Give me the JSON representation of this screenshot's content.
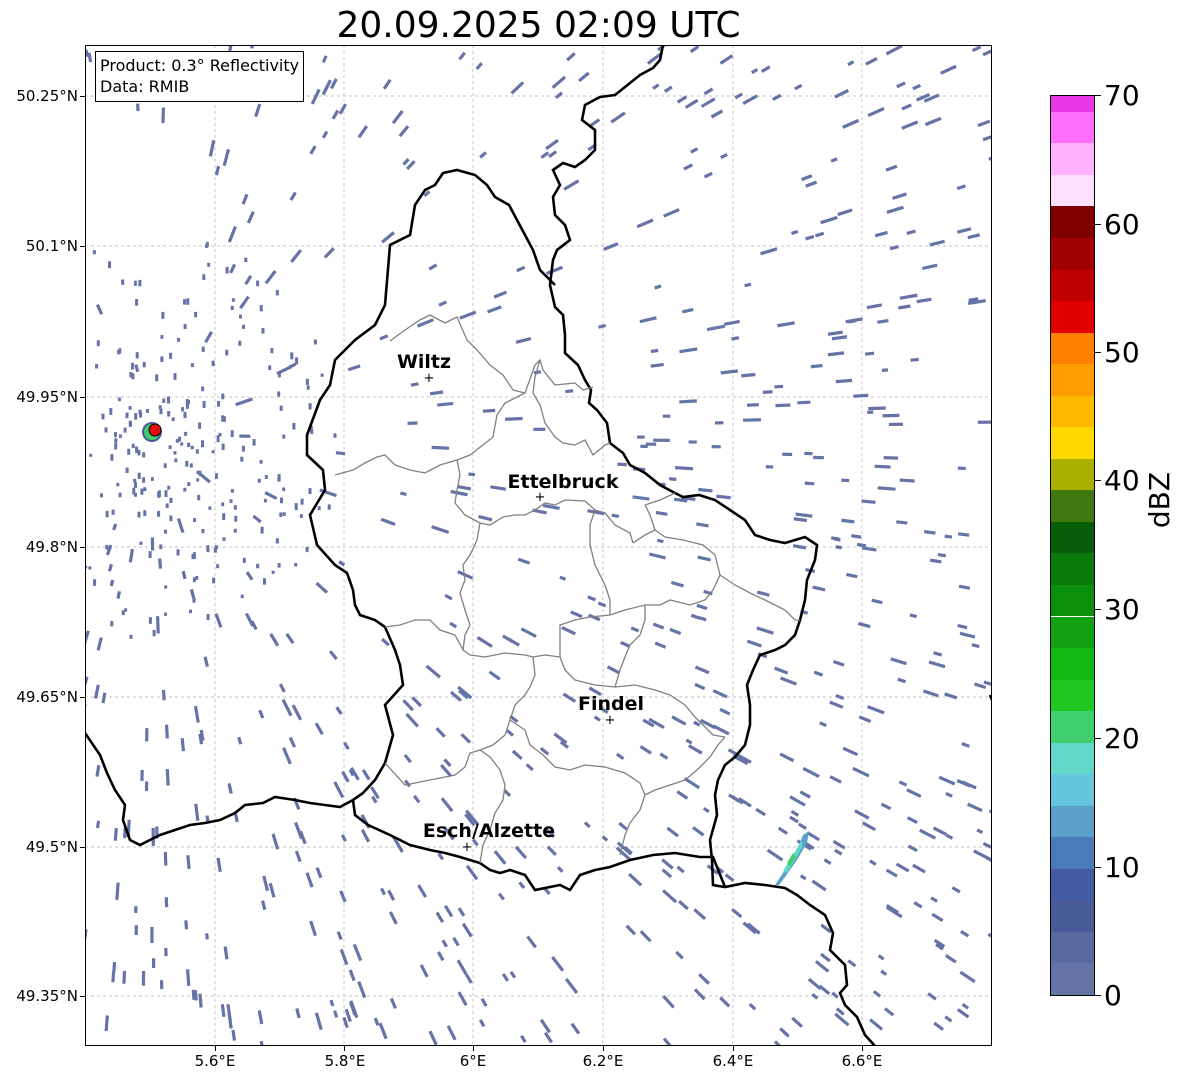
{
  "title": "20.09.2025 02:09 UTC",
  "info": {
    "product": "Product: 0.3° Reflectivity",
    "source": "Data: RMIB"
  },
  "axes": {
    "lat_ticks": [
      "50.25°N",
      "50.1°N",
      "49.95°N",
      "49.8°N",
      "49.65°N",
      "49.5°N",
      "49.35°N"
    ],
    "lon_ticks": [
      "5.6°E",
      "5.8°E",
      "6°E",
      "6.2°E",
      "6.4°E",
      "6.6°E"
    ]
  },
  "cities": [
    {
      "name": "Wiltz"
    },
    {
      "name": "Ettelbruck"
    },
    {
      "name": "Findel"
    },
    {
      "name": "Esch/Alzette"
    }
  ],
  "colorbar": {
    "unit": "dBZ",
    "tick_labels": [
      "0",
      "10",
      "20",
      "30",
      "40",
      "50",
      "60",
      "70"
    ],
    "range": [
      0,
      70
    ],
    "step": 2.5,
    "colors": [
      "#6673a6",
      "#5a6aa0",
      "#4a5c98",
      "#435ba3",
      "#4a7ab8",
      "#5aa0c8",
      "#66c4dc",
      "#62d8c8",
      "#40d070",
      "#1ec820",
      "#14b814",
      "#10a010",
      "#0c900c",
      "#0a7a0a",
      "#085e08",
      "#427810",
      "#aab000",
      "#ffd800",
      "#ffb800",
      "#ff9c00",
      "#ff8000",
      "#e00000",
      "#c00000",
      "#a00000",
      "#800000",
      "#ffe0ff",
      "#ffb0ff",
      "#ff70ff",
      "#e838e8"
    ]
  },
  "map_colors": {
    "echo": "#6673a6",
    "border": "#000000",
    "canton": "#808080",
    "grid": "#b0b0b0",
    "radar_site": "#e01010"
  }
}
